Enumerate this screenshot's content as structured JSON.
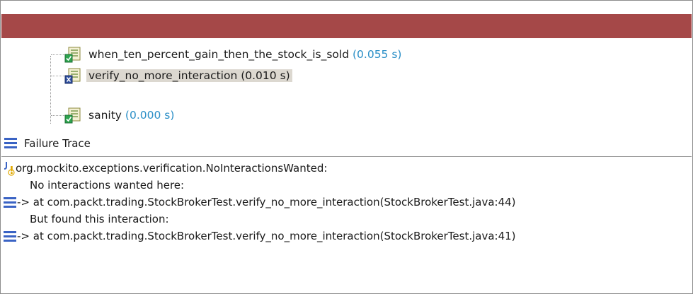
{
  "tree": {
    "items": [
      {
        "name": "when_ten_percent_gain_then_the_stock_is_sold",
        "time": "(0.055 s)",
        "status": "passed"
      },
      {
        "name": "verify_no_more_interaction",
        "time": "(0.010 s)",
        "status": "failed",
        "selected": true
      },
      {
        "name": "sanity",
        "time": "(0.000 s)",
        "status": "passed"
      }
    ]
  },
  "failure_trace": {
    "title": "Failure Trace",
    "lines": [
      "org.mockito.exceptions.verification.NoInteractionsWanted:",
      "No interactions wanted here:",
      "-> at com.packt.trading.StockBrokerTest.verify_no_more_interaction(StockBrokerTest.java:44)",
      "But found this interaction:",
      "-> at com.packt.trading.StockBrokerTest.verify_no_more_interaction(StockBrokerTest.java:41)",
      "***"
    ]
  },
  "colors": {
    "failure_bar": "#a54848",
    "time": "#2b8fc7",
    "stack_icon": "#3a63c4",
    "selection": "#dcd8d0"
  }
}
